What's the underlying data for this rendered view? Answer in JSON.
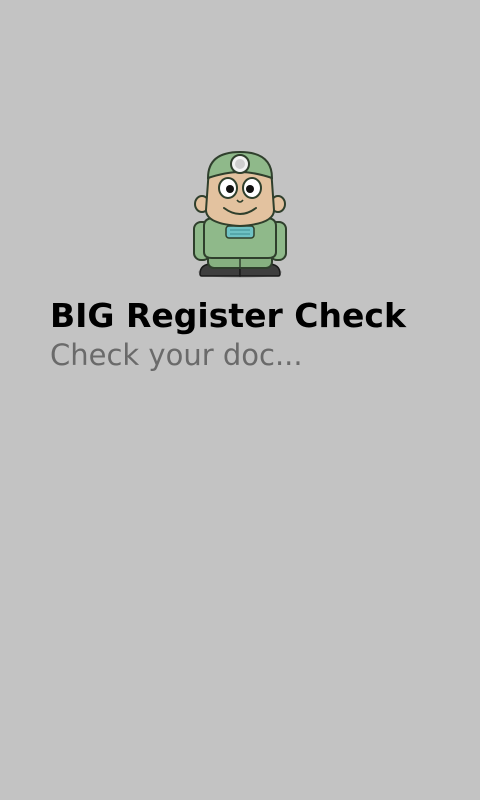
{
  "app": {
    "title": "BIG Register Check",
    "subtitle": "Check your doc...",
    "mascot_icon": "doctor-mascot-icon"
  },
  "colors": {
    "background": "#c3c3c3",
    "title": "#000000",
    "subtitle": "#6a6a6a",
    "scrubs": "#8fb98a",
    "skin": "#e3c29f"
  }
}
